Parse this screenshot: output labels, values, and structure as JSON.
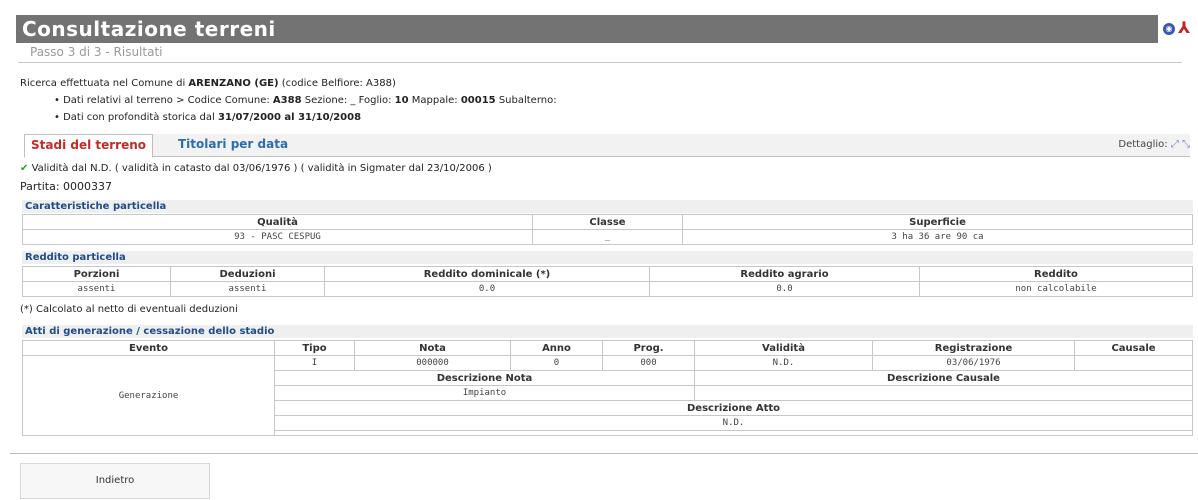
{
  "header": {
    "title": "Consultazione terreni",
    "step": "Passo 3 di 3 - Risultati",
    "icons": [
      "globe-icon",
      "pdf-icon"
    ]
  },
  "search_info": {
    "line1_prefix": "Ricerca effettuata nel Comune di ",
    "comune": "ARENZANO (GE)",
    "line1_suffix": " (codice Belfiore: A388)",
    "bullet1_prefix": "• Dati relativi al terreno > Codice Comune: ",
    "codice": "A388",
    "bullet1_sez": " Sezione: _ Foglio: ",
    "foglio": "10",
    "bullet1_map": " Mappale: ",
    "mappale": "00015",
    "bullet1_sub": " Subalterno:",
    "bullet2_prefix": "• Dati con profondità storica dal ",
    "period": "31/07/2000 al 31/10/2008"
  },
  "tabs": [
    {
      "label": "Stadi del terreno"
    },
    {
      "label": "Titolari per data"
    }
  ],
  "detail_label": "Dettaglio:",
  "validity_text": "Validità dal N.D. ( validità in catasto dal 03/06/1976 ) ( validità in Sigmater dal 23/10/2006 )",
  "partita": "Partita: 0000337",
  "caratteristiche": {
    "title": "Caratteristiche particella",
    "headers": [
      "Qualità",
      "Classe",
      "Superficie"
    ],
    "values": [
      "93 - PASC CESPUG",
      "_",
      "3 ha 36 are 90 ca"
    ]
  },
  "reddito": {
    "title": "Reddito particella",
    "headers": [
      "Porzioni",
      "Deduzioni",
      "Reddito dominicale (*)",
      "Reddito agrario",
      "Reddito"
    ],
    "values": [
      "assenti",
      "assenti",
      "0.0",
      "0.0",
      "non calcolabile"
    ]
  },
  "note": "(*) Calcolato al netto di eventuali deduzioni",
  "atti": {
    "title": "Atti di generazione / cessazione dello stadio",
    "headers": [
      "Evento",
      "Tipo",
      "Nota",
      "Anno",
      "Prog.",
      "Validità",
      "Registrazione",
      "Causale"
    ],
    "row": [
      "Generazione",
      "I",
      "000000",
      "0",
      "000",
      "N.D.",
      "03/06/1976",
      ""
    ],
    "desc_nota_label": "Descrizione Nota",
    "desc_nota_value": "Impianto",
    "desc_causale_label": "Descrizione Causale",
    "desc_causale_value": "",
    "desc_atto_label": "Descrizione Atto",
    "desc_atto_value": "N.D."
  },
  "back_button": "Indietro"
}
